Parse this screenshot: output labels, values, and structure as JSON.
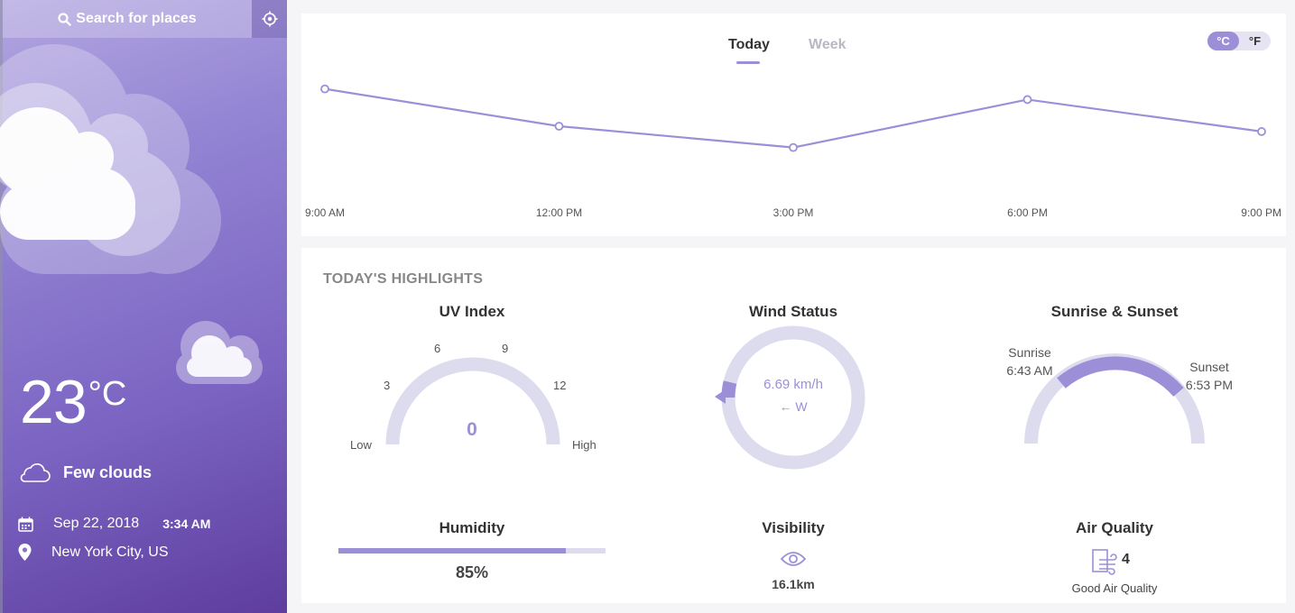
{
  "sidebar": {
    "search_label": "Search for places",
    "temperature": "23",
    "temp_unit": "°C",
    "condition": "Few clouds",
    "date": "Sep 22, 2018",
    "time": "3:34 AM",
    "location": "New York City, US"
  },
  "chart_tabs": {
    "today": "Today",
    "week": "Week"
  },
  "unit_toggle": {
    "celsius": "°C",
    "fahrenheit": "°F",
    "selected": "°C"
  },
  "chart_data": {
    "type": "line",
    "x": [
      "9:00 AM",
      "12:00 PM",
      "3:00 PM",
      "6:00 PM",
      "9:00 PM"
    ],
    "series": [
      {
        "values": [
          25,
          21.5,
          19.5,
          24,
          21
        ]
      }
    ],
    "ylim": [
      16,
      27
    ],
    "grid": false,
    "color": "#9c8fd7"
  },
  "highlights": {
    "title": "TODAY'S HIGHLIGHTS",
    "uv": {
      "title": "UV Index",
      "value": "0",
      "ticks": [
        "3",
        "6",
        "9",
        "12"
      ],
      "low": "Low",
      "high": "High",
      "level_fraction": 0
    },
    "wind": {
      "title": "Wind Status",
      "speed": "6.69 km/h",
      "direction": "← W"
    },
    "sun": {
      "title": "Sunrise & Sunset",
      "sunrise_label": "Sunrise",
      "sunrise_time": "6:43 AM",
      "sunset_label": "Sunset",
      "sunset_time": "6:53 PM"
    },
    "humidity": {
      "title": "Humidity",
      "value": "85%",
      "fraction": 0.85
    },
    "visibility": {
      "title": "Visibility",
      "value": "16.1km"
    },
    "air": {
      "title": "Air Quality",
      "value": "4",
      "label": "Good Air Quality"
    }
  },
  "colors": {
    "accent": "#9c8fd7",
    "track": "#dddcef",
    "sidebar_start": "#b3a6e0",
    "sidebar_end": "#5e3d9e"
  }
}
